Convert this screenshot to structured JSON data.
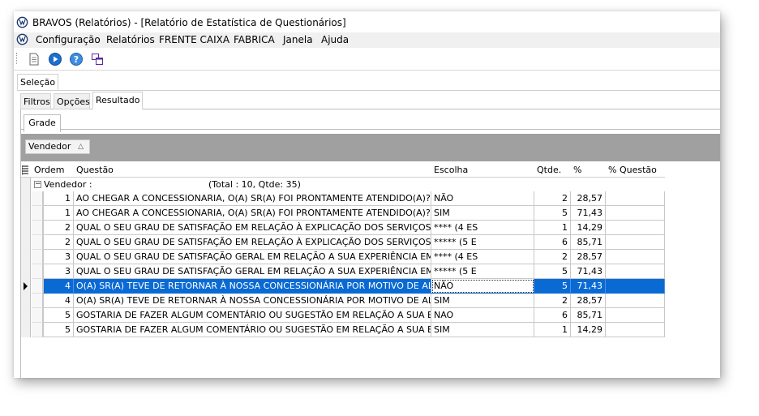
{
  "window": {
    "title": "BRAVOS (Relatórios) - [Relatório de Estatística de Questionários]"
  },
  "menu": {
    "items": [
      "Configuração",
      "Relatórios",
      "FRENTE CAIXA",
      "FABRICA",
      "Janela",
      "Ajuda"
    ]
  },
  "toolbar": {
    "buttons": [
      "document-icon",
      "play-icon",
      "help-icon",
      "window-icon"
    ]
  },
  "tabs": {
    "selecao": "Seleção",
    "filtros": "Filtros",
    "opcoes": "Opções",
    "resultado": "Resultado",
    "grade": "Grade"
  },
  "grouping": {
    "field": "Vendedor",
    "sort_indicator": "△"
  },
  "grid": {
    "columns": [
      "Ordem",
      "Questão",
      "Escolha",
      "Qtde.",
      "%",
      "% Questão"
    ],
    "group_label": "Vendedor :",
    "group_total": "(Total : 10, Qtde: 35)",
    "rows": [
      {
        "ordem": "1",
        "questao": "AO CHEGAR A CONCESSIONARIA, O(A) SR(A) FOI PRONTAMENTE ATENDIDO(A)?",
        "escolha": "NÃO",
        "qtde": "2",
        "pct": "28,57",
        "pct_questao": ""
      },
      {
        "ordem": "1",
        "questao": "AO CHEGAR A CONCESSIONARIA, O(A) SR(A) FOI PRONTAMENTE ATENDIDO(A)?",
        "escolha": "SIM",
        "qtde": "5",
        "pct": "71,43",
        "pct_questao": ""
      },
      {
        "ordem": "2",
        "questao": "QUAL O SEU GRAU DE SATISFAÇÃO EM RELAÇÃO À EXPLICAÇÃO DOS SERVIÇOS?",
        "escolha": "**** (4 ES",
        "qtde": "1",
        "pct": "14,29",
        "pct_questao": ""
      },
      {
        "ordem": "2",
        "questao": "QUAL O SEU GRAU DE SATISFAÇÃO EM RELAÇÃO À EXPLICAÇÃO DOS SERVIÇOS?",
        "escolha": "***** (5 E",
        "qtde": "6",
        "pct": "85,71",
        "pct_questao": ""
      },
      {
        "ordem": "3",
        "questao": "QUAL O SEU GRAU DE SATISFAÇÃO GERAL EM RELAÇÃO A SUA EXPERIÊNCIA EM SEU ATE",
        "escolha": "**** (4 ES",
        "qtde": "2",
        "pct": "28,57",
        "pct_questao": ""
      },
      {
        "ordem": "3",
        "questao": "QUAL O SEU GRAU DE SATISFAÇÃO GERAL EM RELAÇÃO A SUA EXPERIÊNCIA EM SEU ATE",
        "escolha": "***** (5 E",
        "qtde": "5",
        "pct": "71,43",
        "pct_questao": ""
      },
      {
        "ordem": "4",
        "questao": "O(A) SR(A) TEVE DE RETORNAR À NOSSA CONCESSIONÁRIA POR MOTIVO DE ALGUM SER",
        "escolha": "NÃO",
        "qtde": "5",
        "pct": "71,43",
        "pct_questao": ""
      },
      {
        "ordem": "4",
        "questao": "O(A) SR(A) TEVE DE RETORNAR À NOSSA CONCESSIONÁRIA POR MOTIVO DE ALGUM SER",
        "escolha": "SIM",
        "qtde": "2",
        "pct": "28,57",
        "pct_questao": ""
      },
      {
        "ordem": "5",
        "questao": "GOSTARIA DE FAZER ALGUM COMENTÁRIO OU SUGESTÃO EM RELAÇÃO A SUA EXPERIÊN",
        "escolha": "NAO",
        "qtde": "6",
        "pct": "85,71",
        "pct_questao": ""
      },
      {
        "ordem": "5",
        "questao": "GOSTARIA DE FAZER ALGUM COMENTÁRIO OU SUGESTÃO EM RELAÇÃO A SUA EXPERIÊN",
        "escolha": "SIM",
        "qtde": "1",
        "pct": "14,29",
        "pct_questao": ""
      }
    ],
    "selected_row": 6
  },
  "colors": {
    "selection": "#0a6ad4",
    "group_panel": "#a0a0a0"
  }
}
